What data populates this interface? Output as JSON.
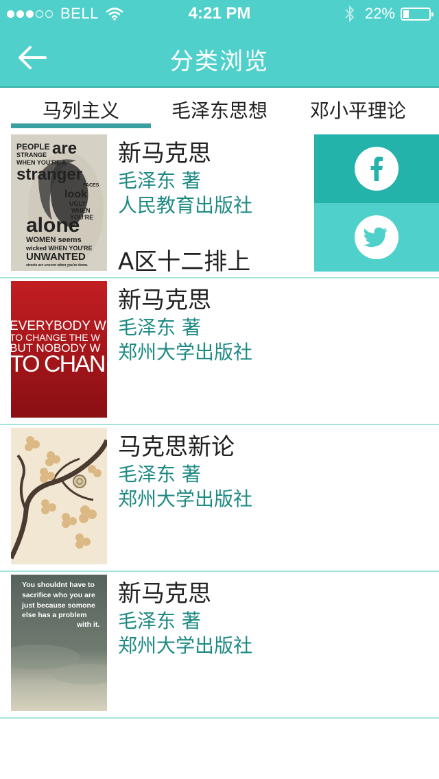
{
  "status_bar": {
    "carrier": "BELL",
    "time": "4:21 PM",
    "battery": "22%",
    "battery_level": 0.22
  },
  "nav": {
    "title": "分类浏览",
    "back_icon": "arrow-left-icon"
  },
  "tabs": [
    {
      "label": "马列主义",
      "selected": true
    },
    {
      "label": "毛泽东思想",
      "selected": false
    },
    {
      "label": "邓小平理论",
      "selected": false
    }
  ],
  "books": [
    {
      "title": "新马克思",
      "author": "毛泽东  著",
      "publisher": "人民教育出版社",
      "location": "A区十二排上",
      "cover_text": [
        "PEOPLE",
        "STRANGE",
        "are",
        "WHEN YOU'RE A",
        "stranger",
        "FACES",
        "look",
        "UGLY",
        "WHEN",
        "YOU'RE",
        "alone",
        "WOMEN seems",
        "wicked WHEN YOU'RE",
        "UNWANTED",
        "streets are uneven when you're down."
      ]
    },
    {
      "title": "新马克思",
      "author": "毛泽东  著",
      "publisher": "郑州大学出版社",
      "cover_text": [
        "EVERYBODY W",
        "TO CHANGE THE W",
        "BUT NOBODY W",
        "TO CHAN"
      ]
    },
    {
      "title": "马克思新论",
      "author": "毛泽东  著",
      "publisher": "郑州大学出版社",
      "cover_text": []
    },
    {
      "title": "新马克思",
      "author": "毛泽东  著",
      "publisher": "郑州大学出版社",
      "cover_text": [
        "You shouldnt have to",
        "sacrifice who you are",
        "just because somone",
        "else has a problem",
        "with it."
      ]
    }
  ],
  "share": {
    "facebook_icon": "facebook-icon",
    "twitter_icon": "twitter-icon"
  },
  "colors": {
    "accent": "#4fd0cb",
    "accent_dark": "#23b3aa",
    "text_teal": "#1e8a84",
    "divider": "#a6e2dc"
  }
}
